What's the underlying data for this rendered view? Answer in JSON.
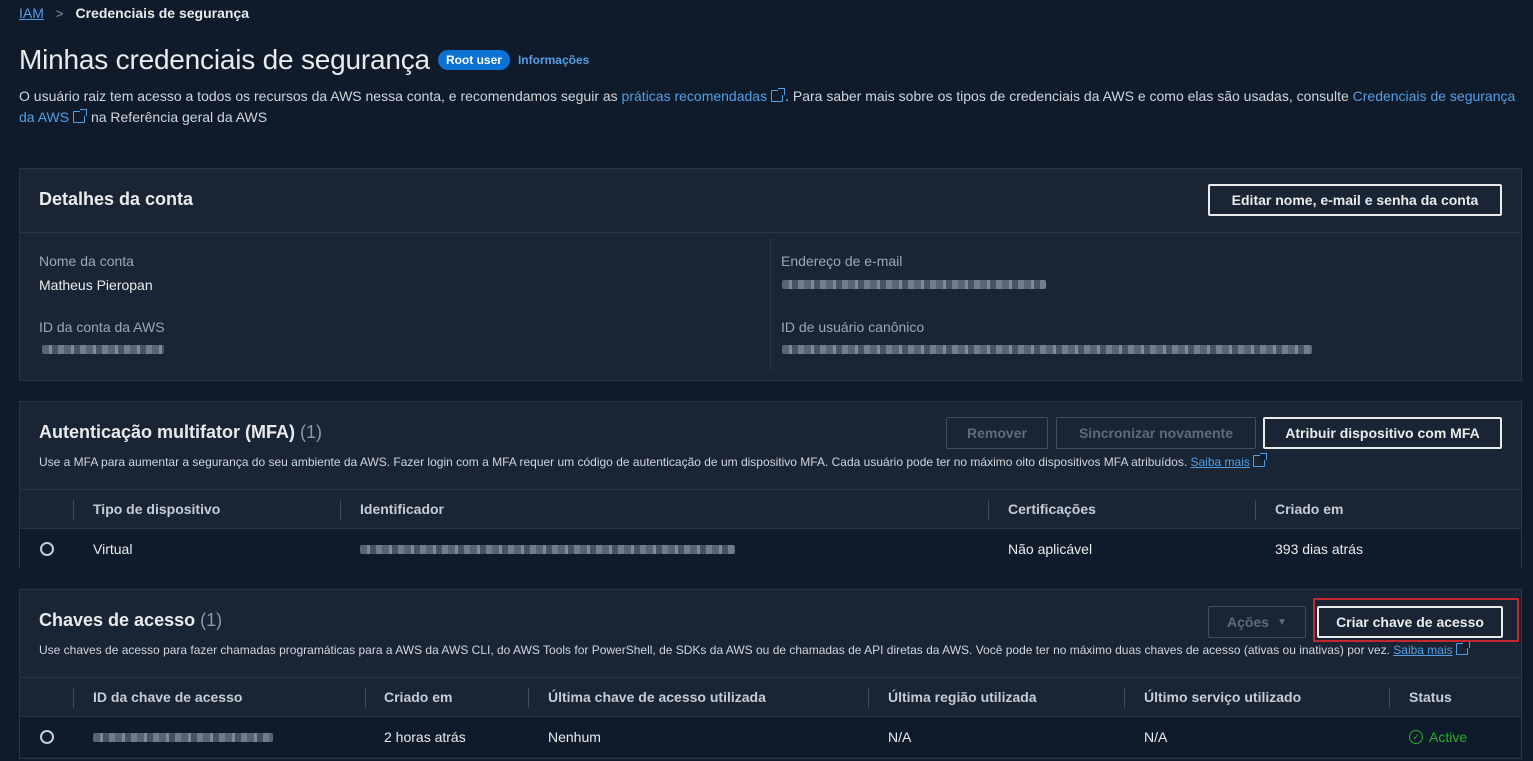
{
  "breadcrumb": {
    "root": "IAM",
    "separator": ">",
    "current": "Credenciais de segurança"
  },
  "header": {
    "title": "Minhas credenciais de segurança",
    "badge": "Root user",
    "info": "Informações"
  },
  "description": {
    "part1": "O usuário raiz tem acesso a todos os recursos da AWS nessa conta, e recomendamos seguir as ",
    "link1": "práticas recomendadas",
    "part2": ". Para saber mais sobre os tipos de credenciais da AWS e como elas são usadas, consulte ",
    "link2": "Credenciais de segurança da AWS",
    "part3": " na Referência geral da AWS"
  },
  "account": {
    "title": "Detalhes da conta",
    "edit_button": "Editar nome, e-mail e senha da conta",
    "name_label": "Nome da conta",
    "name_value": "Matheus Pieropan",
    "account_id_label": "ID da conta da AWS",
    "email_label": "Endereço de e-mail",
    "canonical_label": "ID de usuário canônico"
  },
  "mfa": {
    "title": "Autenticação multifator (MFA)",
    "count": "(1)",
    "description": "Use a MFA para aumentar a segurança do seu ambiente da AWS. Fazer login com a MFA requer um código de autenticação de um dispositivo MFA. Cada usuário pode ter no máximo oito dispositivos MFA atribuídos.",
    "learn_more": "Saiba mais",
    "remove_button": "Remover",
    "resync_button": "Sincronizar novamente",
    "assign_button": "Atribuir dispositivo com MFA",
    "columns": [
      "Tipo de dispositivo",
      "Identificador",
      "Certificações",
      "Criado em"
    ],
    "rows": [
      {
        "type": "Virtual",
        "certifications": "Não aplicável",
        "created": "393 dias atrás"
      }
    ]
  },
  "keys": {
    "title": "Chaves de acesso",
    "count": "(1)",
    "description": "Use chaves de acesso para fazer chamadas programáticas para a AWS da AWS CLI, do AWS Tools for PowerShell, de SDKs da AWS ou de chamadas de API diretas da AWS. Você pode ter no máximo duas chaves de acesso (ativas ou inativas) por vez.",
    "learn_more": "Saiba mais",
    "actions_button": "Ações",
    "create_button": "Criar chave de acesso",
    "columns": [
      "ID da chave de acesso",
      "Criado em",
      "Última chave de acesso utilizada",
      "Última região utilizada",
      "Último serviço utilizado",
      "Status"
    ],
    "rows": [
      {
        "created": "2 horas atrás",
        "last_key": "Nenhum",
        "last_region": "N/A",
        "last_service": "N/A",
        "status": "Active"
      }
    ]
  },
  "colors": {
    "background": "#0f1b2a",
    "panel": "#192534",
    "link": "#539fe5",
    "badge": "#0972d3",
    "active": "#29ad32",
    "highlight": "#c4272c"
  }
}
